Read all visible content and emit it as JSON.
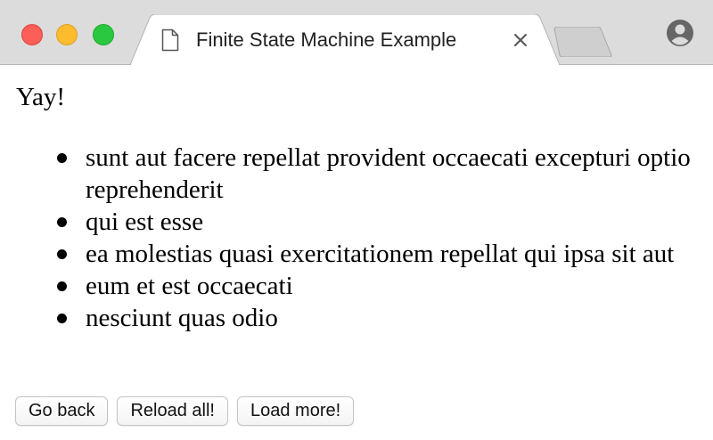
{
  "browser": {
    "tab_title": "Finite State Machine Example",
    "tab_icon": "document-icon",
    "close_icon": "close-icon",
    "profile_icon": "profile-icon"
  },
  "page": {
    "heading": "Yay!",
    "posts": [
      "sunt aut facere repellat provident occaecati excepturi optio reprehenderit",
      "qui est esse",
      "ea molestias quasi exercitationem repellat qui ipsa sit aut",
      "eum et est occaecati",
      "nesciunt quas odio"
    ],
    "buttons": {
      "go_back": "Go back",
      "reload_all": "Reload all!",
      "load_more": "Load more!"
    }
  },
  "colors": {
    "close": "#fc5f57",
    "minimize": "#fdbc2e",
    "zoom": "#29c840",
    "chrome_bg": "#dcdcdc"
  }
}
